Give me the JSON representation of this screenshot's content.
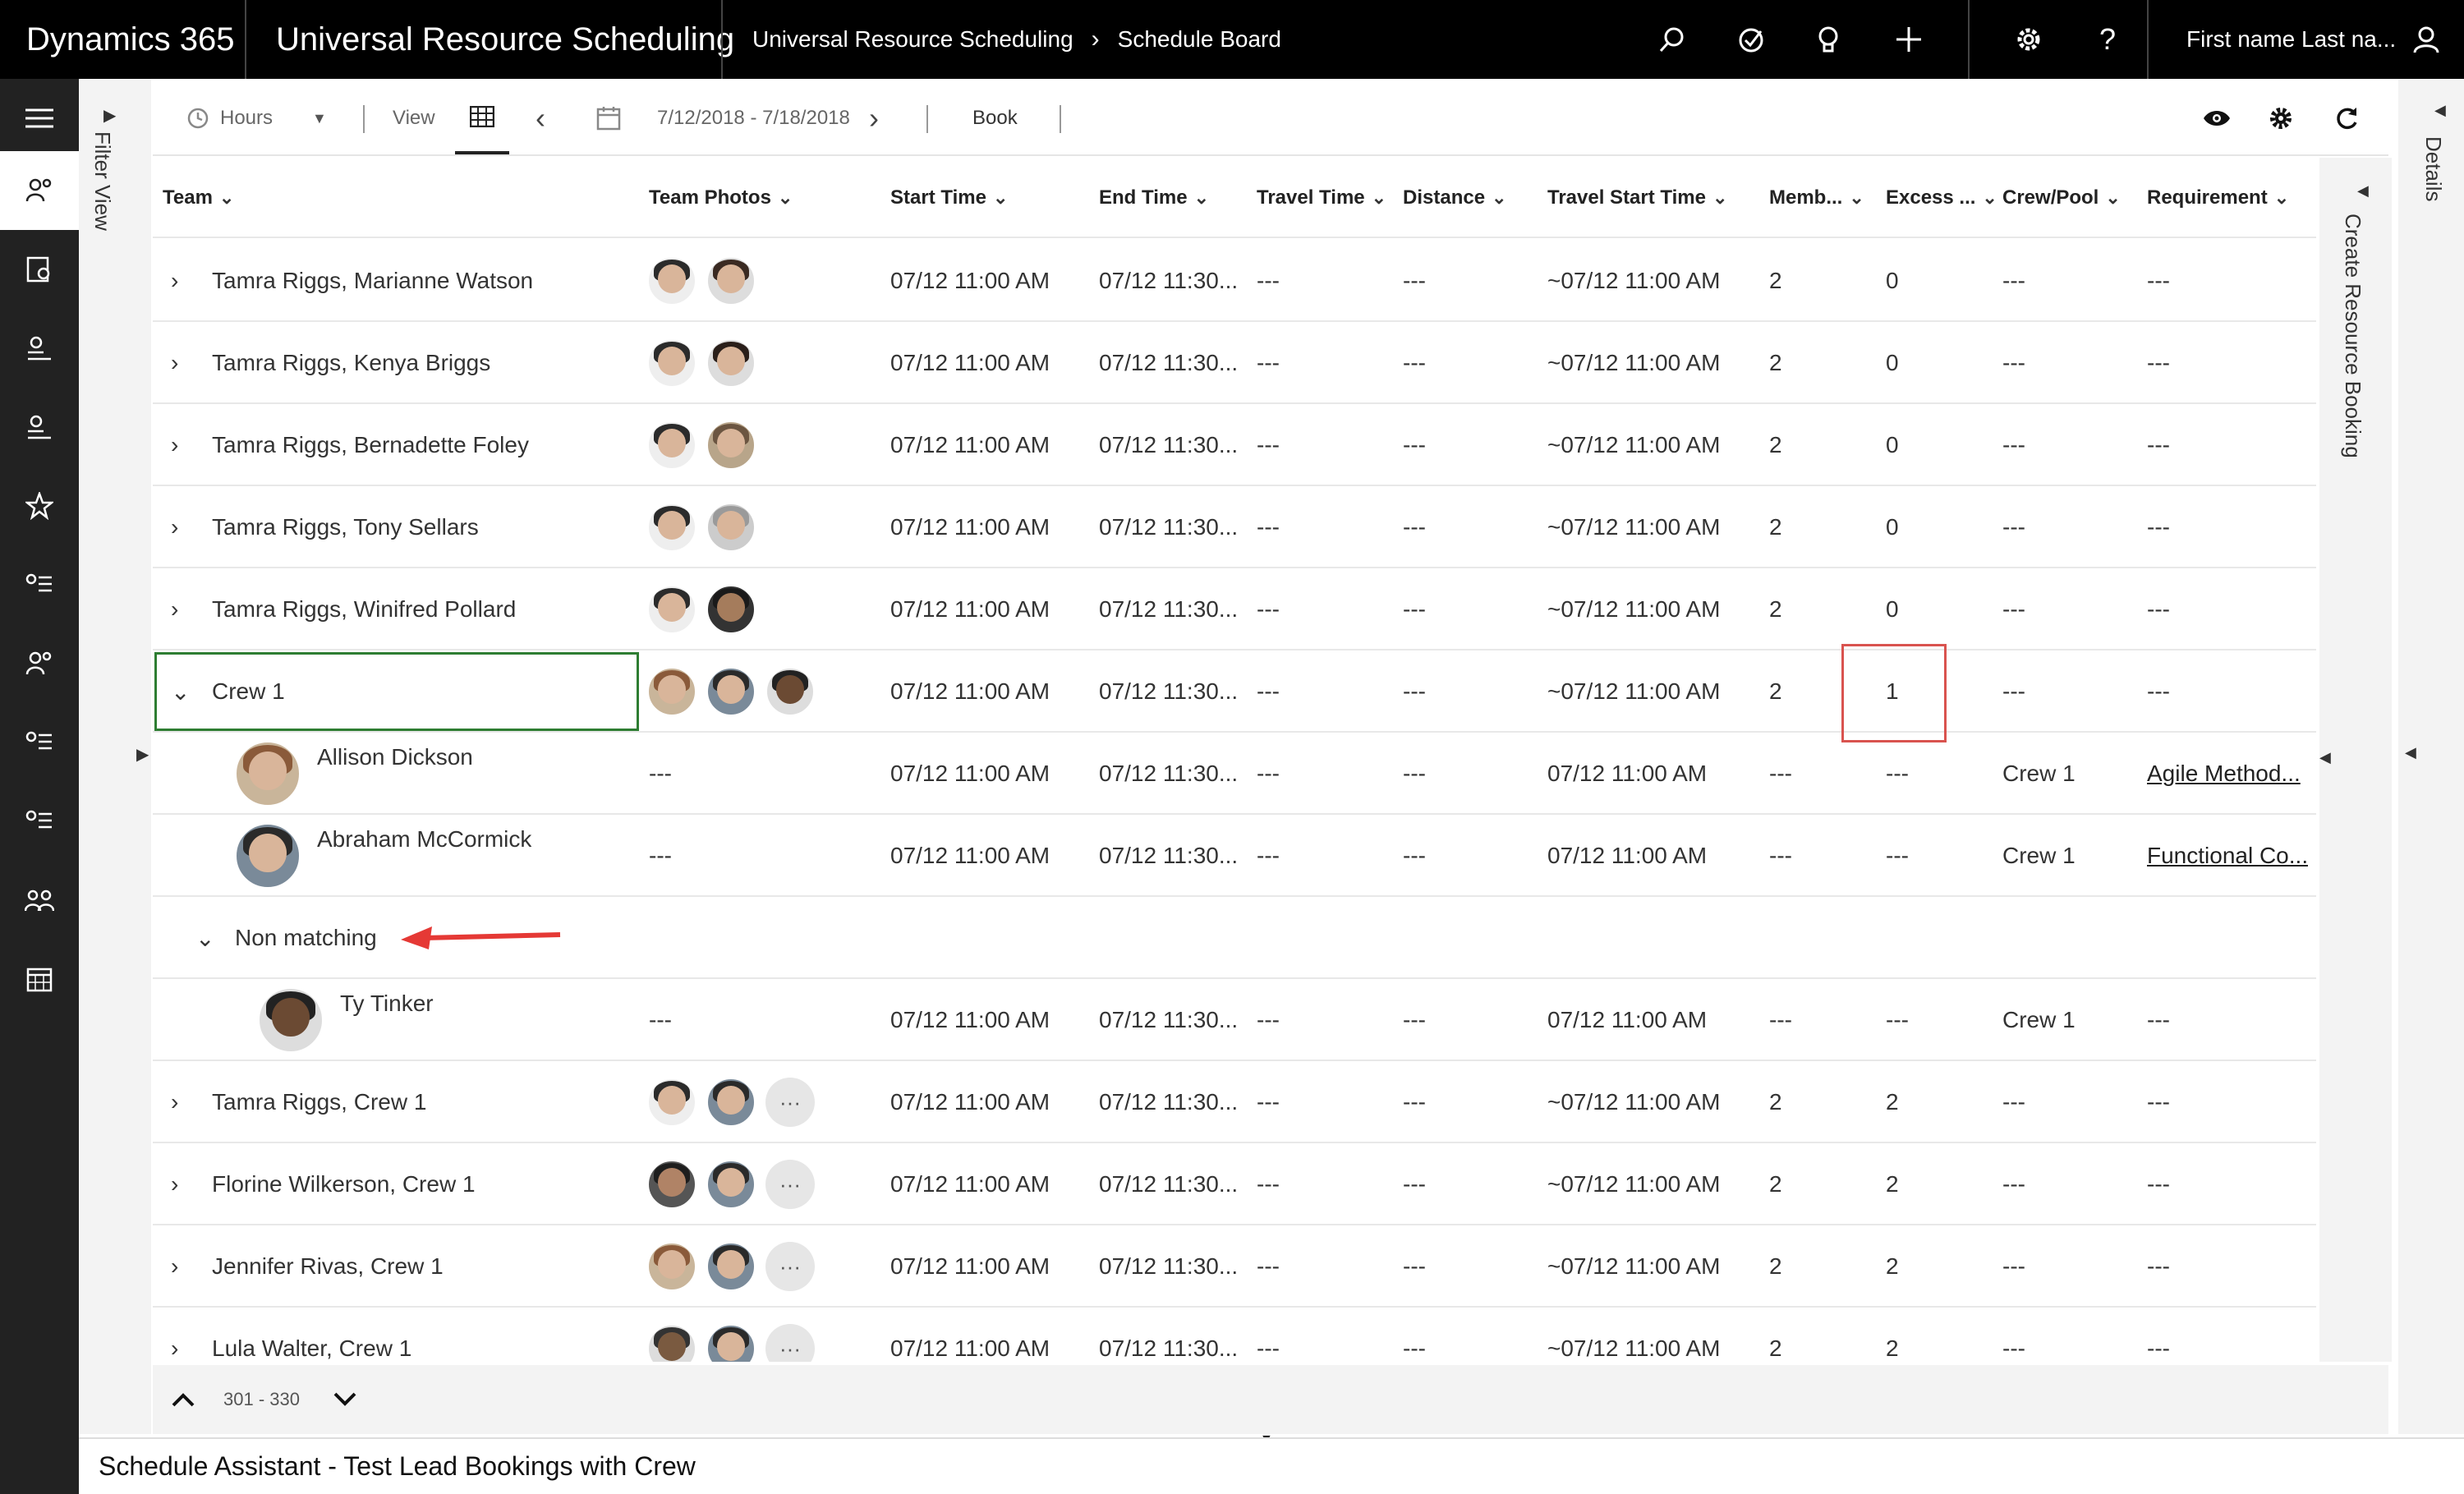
{
  "topbar": {
    "brand": "Dynamics 365",
    "app_name": "Universal Resource Scheduling",
    "breadcrumb": [
      "Universal Resource Scheduling",
      "Schedule Board"
    ],
    "user_name": "First name Last na..."
  },
  "filter_view_label": "Filter View",
  "toolbar": {
    "hours_label": "Hours",
    "view_label": "View",
    "date_range": "7/12/2018 - 7/18/2018",
    "book_label": "Book"
  },
  "grid": {
    "headers": [
      "Team",
      "Team Photos",
      "Start Time",
      "End Time",
      "Travel Time",
      "Distance",
      "Travel Start Time",
      "Memb...",
      "Excess ...",
      "Crew/Pool",
      "Requirement"
    ],
    "rows": [
      {
        "team": "Tamra Riggs, Marianne Watson",
        "start": "07/12 11:00 AM",
        "end": "07/12 11:30...",
        "travel": "---",
        "distance": "---",
        "travel_start": "~07/12 11:00 AM",
        "members": "2",
        "excess": "0",
        "crew": "---",
        "requirement": "---"
      },
      {
        "team": "Tamra Riggs, Kenya Briggs",
        "start": "07/12 11:00 AM",
        "end": "07/12 11:30...",
        "travel": "---",
        "distance": "---",
        "travel_start": "~07/12 11:00 AM",
        "members": "2",
        "excess": "0",
        "crew": "---",
        "requirement": "---"
      },
      {
        "team": "Tamra Riggs, Bernadette Foley",
        "start": "07/12 11:00 AM",
        "end": "07/12 11:30...",
        "travel": "---",
        "distance": "---",
        "travel_start": "~07/12 11:00 AM",
        "members": "2",
        "excess": "0",
        "crew": "---",
        "requirement": "---"
      },
      {
        "team": "Tamra Riggs, Tony Sellars",
        "start": "07/12 11:00 AM",
        "end": "07/12 11:30...",
        "travel": "---",
        "distance": "---",
        "travel_start": "~07/12 11:00 AM",
        "members": "2",
        "excess": "0",
        "crew": "---",
        "requirement": "---"
      },
      {
        "team": "Tamra Riggs, Winifred Pollard",
        "start": "07/12 11:00 AM",
        "end": "07/12 11:30...",
        "travel": "---",
        "distance": "---",
        "travel_start": "~07/12 11:00 AM",
        "members": "2",
        "excess": "0",
        "crew": "---",
        "requirement": "---"
      },
      {
        "team": "Crew 1",
        "start": "07/12 11:00 AM",
        "end": "07/12 11:30...",
        "travel": "---",
        "distance": "---",
        "travel_start": "~07/12 11:00 AM",
        "members": "2",
        "excess": "1",
        "crew": "---",
        "requirement": "---"
      },
      {
        "team": "Allison Dickson",
        "photos": "---",
        "start": "07/12 11:00 AM",
        "end": "07/12 11:30...",
        "travel": "---",
        "distance": "---",
        "travel_start": "07/12 11:00 AM",
        "members": "---",
        "excess": "---",
        "crew": "Crew 1",
        "requirement": "Agile Method..."
      },
      {
        "team": "Abraham McCormick",
        "photos": "---",
        "start": "07/12 11:00 AM",
        "end": "07/12 11:30...",
        "travel": "---",
        "distance": "---",
        "travel_start": "07/12 11:00 AM",
        "members": "---",
        "excess": "---",
        "crew": "Crew 1",
        "requirement": "Functional Co..."
      },
      {
        "team": "Non matching"
      },
      {
        "team": "Ty Tinker",
        "photos": "---",
        "start": "07/12 11:00 AM",
        "end": "07/12 11:30...",
        "travel": "---",
        "distance": "---",
        "travel_start": "07/12 11:00 AM",
        "members": "---",
        "excess": "---",
        "crew": "Crew 1",
        "requirement": "---"
      },
      {
        "team": "Tamra Riggs, Crew 1",
        "start": "07/12 11:00 AM",
        "end": "07/12 11:30...",
        "travel": "---",
        "distance": "---",
        "travel_start": "~07/12 11:00 AM",
        "members": "2",
        "excess": "2",
        "crew": "---",
        "requirement": "---"
      },
      {
        "team": "Florine Wilkerson, Crew 1",
        "start": "07/12 11:00 AM",
        "end": "07/12 11:30...",
        "travel": "---",
        "distance": "---",
        "travel_start": "~07/12 11:00 AM",
        "members": "2",
        "excess": "2",
        "crew": "---",
        "requirement": "---"
      },
      {
        "team": "Jennifer Rivas, Crew 1",
        "start": "07/12 11:00 AM",
        "end": "07/12 11:30...",
        "travel": "---",
        "distance": "---",
        "travel_start": "~07/12 11:00 AM",
        "members": "2",
        "excess": "2",
        "crew": "---",
        "requirement": "---"
      },
      {
        "team": "Lula Walter, Crew 1",
        "start": "07/12 11:00 AM",
        "end": "07/12 11:30...",
        "travel": "---",
        "distance": "---",
        "travel_start": "~07/12 11:00 AM",
        "members": "2",
        "excess": "2",
        "crew": "---",
        "requirement": "---"
      }
    ]
  },
  "create_booking_label": "Create Resource Booking",
  "details_label": "Details",
  "pager": {
    "range": "301 - 330"
  },
  "status_title": "Schedule Assistant - Test Lead Bookings with Crew",
  "colors": {
    "topbar": "#000000",
    "nav": "#222222",
    "selected_border": "#2e7d32",
    "highlight_box": "#d9534f",
    "arrow": "#e53935"
  },
  "icons": [
    "search-icon",
    "task-icon",
    "lightbulb-icon",
    "plus-icon",
    "gear-icon",
    "help-icon",
    "user-icon",
    "hamburger-icon",
    "clock-icon",
    "grid-icon",
    "calendar-icon",
    "eye-icon",
    "settings-icon",
    "refresh-icon"
  ]
}
